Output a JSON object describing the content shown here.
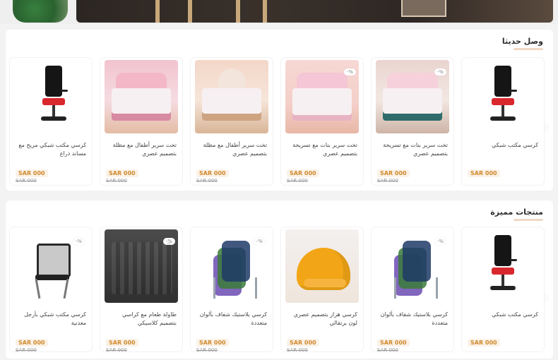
{
  "sections": [
    {
      "title": "وصل حديثا",
      "cards": [
        {
          "name": "كرسي مكتب شبكي",
          "price": "SAR 000",
          "old_price": "",
          "badge": ""
        },
        {
          "name": "تخت سرير بنات مع تسريحة بتصميم عصري",
          "price": "SAR 000",
          "old_price": "SAR 000",
          "badge": "-%"
        },
        {
          "name": "تخت سرير بنات مع تسريحة بتصميم عصري",
          "price": "SAR 000",
          "old_price": "SAR 000",
          "badge": "-%"
        },
        {
          "name": "تخت سرير أطفال مع مظلة بتصميم عصري",
          "price": "SAR 000",
          "old_price": "SAR 000",
          "badge": ""
        },
        {
          "name": "تخت سرير أطفال مع مظلة بتصميم عصري",
          "price": "SAR 000",
          "old_price": "SAR 000",
          "badge": ""
        },
        {
          "name": "كرسي مكتب شبكي مريح مع مساند ذراع",
          "price": "SAR 000",
          "old_price": "SAR 000",
          "badge": ""
        }
      ]
    },
    {
      "title": "منتجات مميزة",
      "cards": [
        {
          "name": "كرسي مكتب شبكي",
          "price": "SAR 000",
          "old_price": "",
          "badge": ""
        },
        {
          "name": "كرسي بلاستيك شفاف بألوان متعددة",
          "price": "SAR 000",
          "old_price": "SAR 000",
          "badge": "-%"
        },
        {
          "name": "كرسي هزاز بتصميم عصري لون برتقالي",
          "price": "SAR 000",
          "old_price": "SAR 000",
          "badge": ""
        },
        {
          "name": "كرسي بلاستيك شفاف بألوان متعددة",
          "price": "SAR 000",
          "old_price": "SAR 000",
          "badge": "-%"
        },
        {
          "name": "طاولة طعام مع كراسي بتصميم كلاسيكي",
          "price": "SAR 000",
          "old_price": "SAR 000",
          "badge": "-%"
        },
        {
          "name": "كرسي مكتب شبكي بأرجل معدنية",
          "price": "SAR 000",
          "old_price": "SAR 000",
          "badge": "-%"
        }
      ]
    }
  ],
  "ui": {
    "arrow_left": "‹",
    "arrow_right": "›"
  },
  "colors": {
    "price": "#d08a2e",
    "badge_bg": "#ffffff",
    "accent_underline": "#f0d9c5"
  }
}
